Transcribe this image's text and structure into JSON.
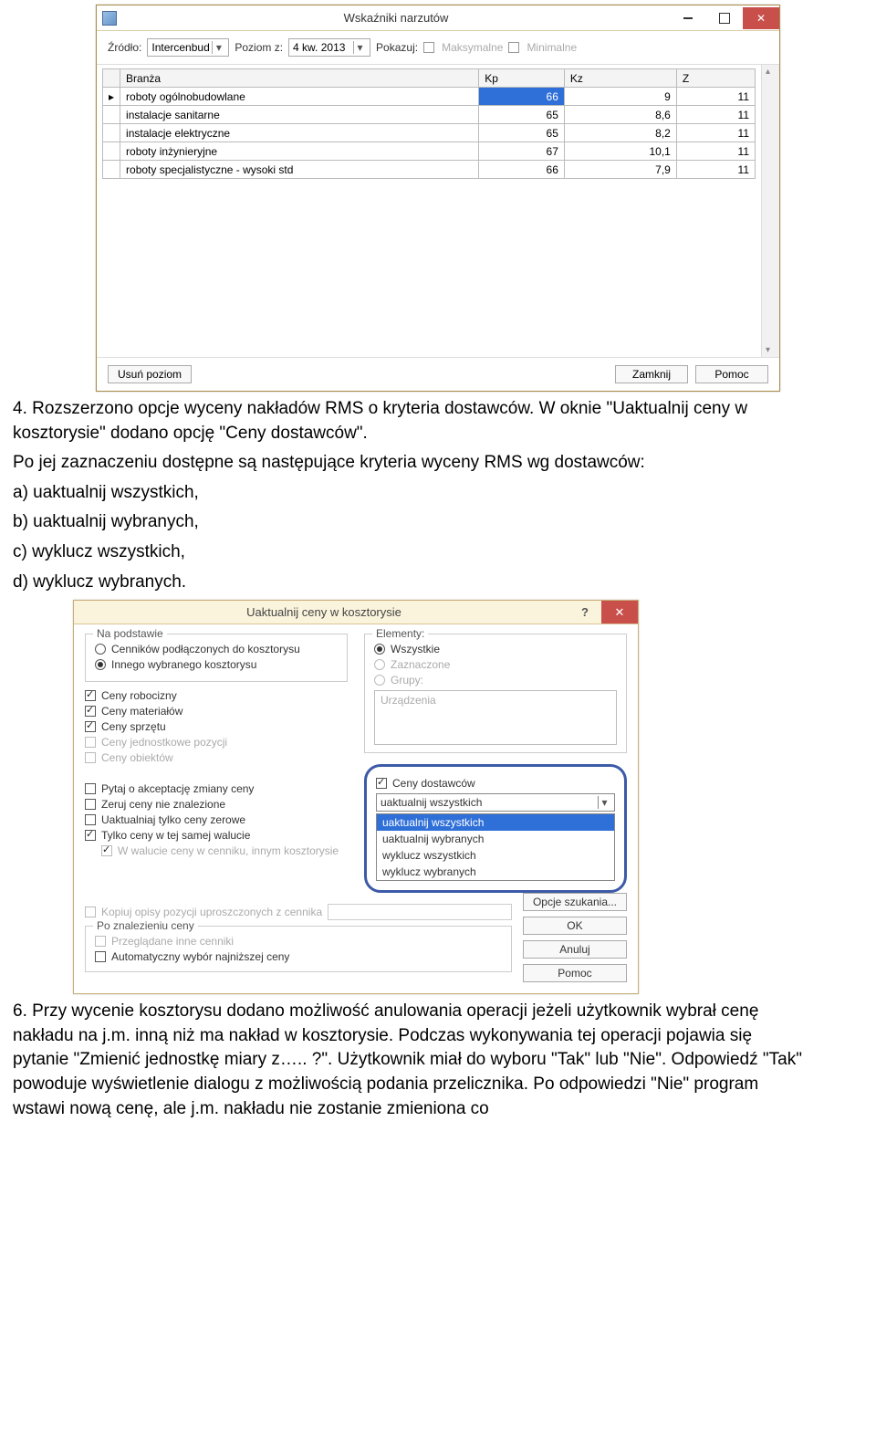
{
  "window1": {
    "title": "Wskaźniki narzutów",
    "toolbar": {
      "source_label": "Źródło:",
      "source_value": "Intercenbud",
      "level_label": "Poziom z:",
      "level_value": "4 kw. 2013",
      "show_label": "Pokazuj:",
      "max_label": "Maksymalne",
      "min_label": "Minimalne"
    },
    "columns": [
      "Branża",
      "Kp",
      "Kz",
      "Z"
    ],
    "rows": [
      {
        "name": "roboty ogólnobudowlane",
        "kp": "66",
        "kz": "9",
        "z": "11",
        "sel": true,
        "ptr": true
      },
      {
        "name": "instalacje sanitarne",
        "kp": "65",
        "kz": "8,6",
        "z": "11"
      },
      {
        "name": "instalacje elektryczne",
        "kp": "65",
        "kz": "8,2",
        "z": "11"
      },
      {
        "name": "roboty inżynieryjne",
        "kp": "67",
        "kz": "10,1",
        "z": "11"
      },
      {
        "name": "roboty specjalistyczne - wysoki std",
        "kp": "66",
        "kz": "7,9",
        "z": "11"
      }
    ],
    "footer": {
      "remove": "Usuń poziom",
      "close": "Zamknij",
      "help": "Pomoc"
    }
  },
  "text4": {
    "p1": "4. Rozszerzono opcje wyceny nakładów RMS o kryteria dostawców. W oknie \"Uaktualnij ceny w kosztorysie\" dodano opcję \"Ceny dostawców\".",
    "p2": "Po jej zaznaczeniu dostępne są następujące kryteria wyceny RMS wg dostawców:",
    "a": "a) uaktualnij wszystkich,",
    "b": "b) uaktualnij wybranych,",
    "c": "c) wyklucz wszystkich,",
    "d": "d) wyklucz wybranych."
  },
  "window2": {
    "title": "Uaktualnij ceny w kosztorysie",
    "basis": {
      "legend": "Na podstawie",
      "opt1": "Cenników podłączonych do kosztorysu",
      "opt2": "Innego wybranego kosztorysu"
    },
    "checks": {
      "c1": "Ceny robocizny",
      "c2": "Ceny materiałów",
      "c3": "Ceny sprzętu",
      "c4": "Ceny jednostkowe pozycji",
      "c5": "Ceny obiektów"
    },
    "left2": {
      "a": "Pytaj o akceptację zmiany ceny",
      "b": "Zeruj ceny nie znalezione",
      "c": "Uaktualniaj tylko ceny zerowe",
      "d": "Tylko ceny w tej samej walucie",
      "e": "W walucie ceny w cenniku, innym kosztorysie"
    },
    "elements": {
      "legend": "Elementy:",
      "o1": "Wszystkie",
      "o2": "Zaznaczone",
      "o3": "Grupy:",
      "field": "Urządzenia"
    },
    "supplier": {
      "chk": "Ceny dostawców",
      "sel": "uaktualnij wszystkich",
      "items": [
        "uaktualnij wszystkich",
        "uaktualnij wybranych",
        "wyklucz wszystkich",
        "wyklucz wybranych"
      ]
    },
    "copy": "Kopiuj opisy pozycji uproszczonych z cennika",
    "after": {
      "legend": "Po znalezieniu ceny",
      "a": "Przeglądane inne cenniki",
      "b": "Automatyczny wybór najniższej ceny"
    },
    "buttons": {
      "search": "Opcje szukania...",
      "ok": "OK",
      "cancel": "Anuluj",
      "help": "Pomoc"
    }
  },
  "text6": "6. Przy wycenie kosztorysu dodano możliwość anulowania operacji jeżeli użytkownik wybrał cenę nakładu na j.m. inną niż ma nakład w kosztorysie. Podczas wykonywania tej operacji pojawia się pytanie \"Zmienić jednostkę miary z….. ?\". Użytkownik miał do wyboru \"Tak\" lub \"Nie\". Odpowiedź \"Tak\" powoduje wyświetlenie dialogu z możliwością podania przelicznika. Po odpowiedzi \"Nie\" program wstawi nową cenę, ale j.m. nakładu nie zostanie zmieniona co"
}
